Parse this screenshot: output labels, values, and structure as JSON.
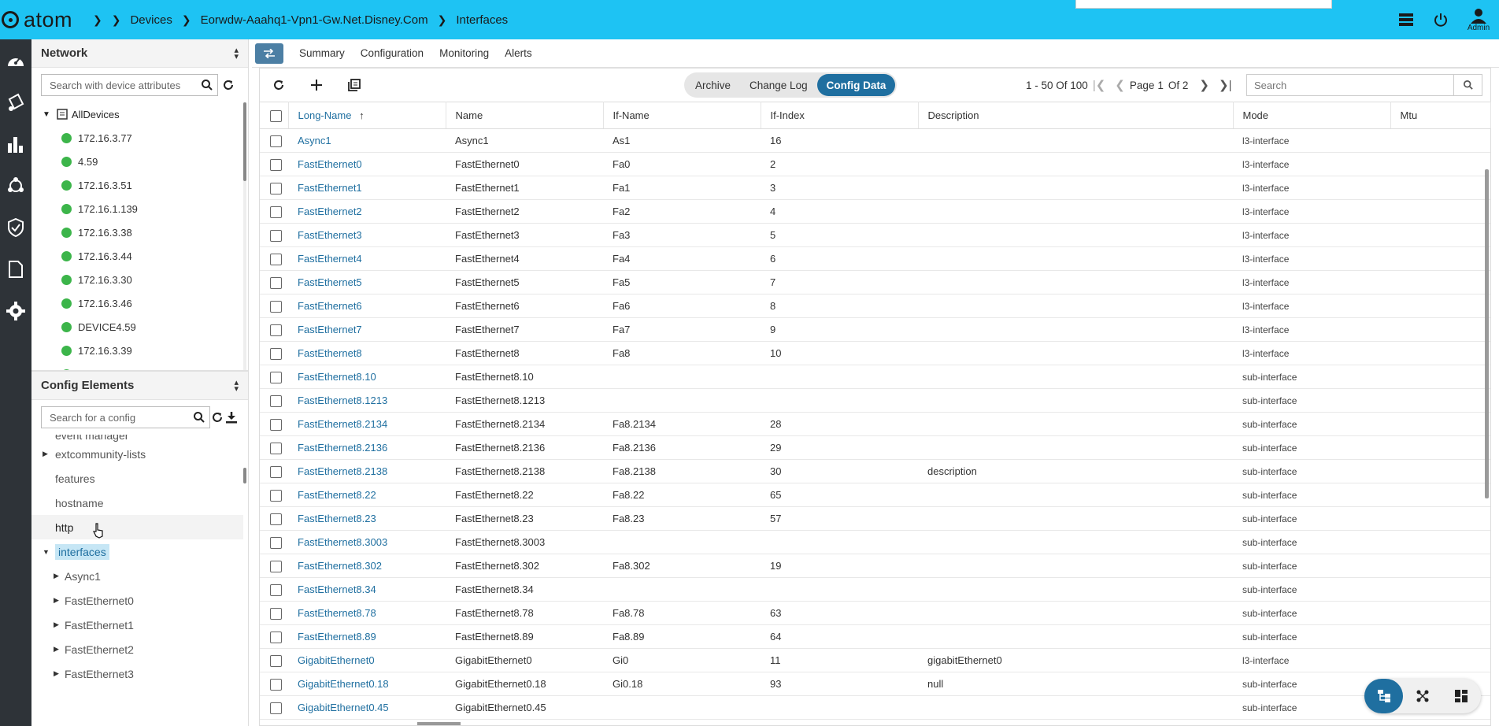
{
  "app": {
    "logo_text": "atom"
  },
  "breadcrumb": [
    "Devices",
    "Eorwdw-Aaahq1-Vpn1-Gw.Net.Disney.Com",
    "Interfaces"
  ],
  "user": {
    "label": "Admin"
  },
  "rail": {
    "icons": [
      "dashboard-icon",
      "inventory-icon",
      "analytics-icon",
      "topology-icon",
      "compliance-icon",
      "document-icon",
      "settings-icon"
    ]
  },
  "network_panel": {
    "title": "Network",
    "search_placeholder": "Search with device attributes",
    "root": "AllDevices",
    "devices": [
      "172.16.3.77",
      "4.59",
      "172.16.3.51",
      "172.16.1.139",
      "172.16.3.38",
      "172.16.3.44",
      "172.16.3.30",
      "172.16.3.46",
      "DEVICE4.59",
      "172.16.3.39"
    ]
  },
  "config_panel": {
    "title": "Config Elements",
    "search_placeholder": "Search for a config",
    "partial_item": "event manager",
    "items": [
      "extcommunity-lists",
      "features",
      "hostname",
      "http",
      "interfaces"
    ],
    "children": [
      "Async1",
      "FastEthernet0",
      "FastEthernet1",
      "FastEthernet2",
      "FastEthernet3"
    ]
  },
  "subnav": {
    "tabs": [
      "Summary",
      "Configuration",
      "Monitoring",
      "Alerts"
    ]
  },
  "toolbar": {
    "segments": [
      "Archive",
      "Change Log",
      "Config Data"
    ],
    "active_segment": "Config Data",
    "range": "1 - 50 Of 100",
    "page_label": "Page",
    "page": "1",
    "of_label": "Of 2",
    "search_placeholder": "Search"
  },
  "table": {
    "columns": [
      "Long-Name",
      "Name",
      "If-Name",
      "If-Index",
      "Description",
      "Mode",
      "Mtu"
    ],
    "rows": [
      [
        "Async1",
        "Async1",
        "As1",
        "16",
        "",
        "l3-interface",
        ""
      ],
      [
        "FastEthernet0",
        "FastEthernet0",
        "Fa0",
        "2",
        "",
        "l3-interface",
        ""
      ],
      [
        "FastEthernet1",
        "FastEthernet1",
        "Fa1",
        "3",
        "",
        "l3-interface",
        ""
      ],
      [
        "FastEthernet2",
        "FastEthernet2",
        "Fa2",
        "4",
        "",
        "l3-interface",
        ""
      ],
      [
        "FastEthernet3",
        "FastEthernet3",
        "Fa3",
        "5",
        "",
        "l3-interface",
        ""
      ],
      [
        "FastEthernet4",
        "FastEthernet4",
        "Fa4",
        "6",
        "",
        "l3-interface",
        ""
      ],
      [
        "FastEthernet5",
        "FastEthernet5",
        "Fa5",
        "7",
        "",
        "l3-interface",
        ""
      ],
      [
        "FastEthernet6",
        "FastEthernet6",
        "Fa6",
        "8",
        "",
        "l3-interface",
        ""
      ],
      [
        "FastEthernet7",
        "FastEthernet7",
        "Fa7",
        "9",
        "",
        "l3-interface",
        ""
      ],
      [
        "FastEthernet8",
        "FastEthernet8",
        "Fa8",
        "10",
        "",
        "l3-interface",
        ""
      ],
      [
        "FastEthernet8.10",
        "FastEthernet8.10",
        "",
        "",
        "",
        "sub-interface",
        ""
      ],
      [
        "FastEthernet8.1213",
        "FastEthernet8.1213",
        "",
        "",
        "",
        "sub-interface",
        ""
      ],
      [
        "FastEthernet8.2134",
        "FastEthernet8.2134",
        "Fa8.2134",
        "28",
        "",
        "sub-interface",
        ""
      ],
      [
        "FastEthernet8.2136",
        "FastEthernet8.2136",
        "Fa8.2136",
        "29",
        "",
        "sub-interface",
        ""
      ],
      [
        "FastEthernet8.2138",
        "FastEthernet8.2138",
        "Fa8.2138",
        "30",
        "description",
        "sub-interface",
        ""
      ],
      [
        "FastEthernet8.22",
        "FastEthernet8.22",
        "Fa8.22",
        "65",
        "",
        "sub-interface",
        ""
      ],
      [
        "FastEthernet8.23",
        "FastEthernet8.23",
        "Fa8.23",
        "57",
        "",
        "sub-interface",
        ""
      ],
      [
        "FastEthernet8.3003",
        "FastEthernet8.3003",
        "",
        "",
        "",
        "sub-interface",
        ""
      ],
      [
        "FastEthernet8.302",
        "FastEthernet8.302",
        "Fa8.302",
        "19",
        "",
        "sub-interface",
        ""
      ],
      [
        "FastEthernet8.34",
        "FastEthernet8.34",
        "",
        "",
        "",
        "sub-interface",
        ""
      ],
      [
        "FastEthernet8.78",
        "FastEthernet8.78",
        "Fa8.78",
        "63",
        "",
        "sub-interface",
        ""
      ],
      [
        "FastEthernet8.89",
        "FastEthernet8.89",
        "Fa8.89",
        "64",
        "",
        "sub-interface",
        ""
      ],
      [
        "GigabitEthernet0",
        "GigabitEthernet0",
        "Gi0",
        "11",
        "gigabitEthernet0",
        "l3-interface",
        ""
      ],
      [
        "GigabitEthernet0.18",
        "GigabitEthernet0.18",
        "Gi0.18",
        "93",
        "null",
        "sub-interface",
        ""
      ],
      [
        "GigabitEthernet0.45",
        "GigabitEthernet0.45",
        "",
        "",
        "",
        "sub-interface",
        ""
      ]
    ]
  },
  "colors": {
    "topbar": "#1ec3f3",
    "rail": "#2e3338",
    "accent": "#1f6fa0",
    "status_up": "#3cb54a"
  }
}
